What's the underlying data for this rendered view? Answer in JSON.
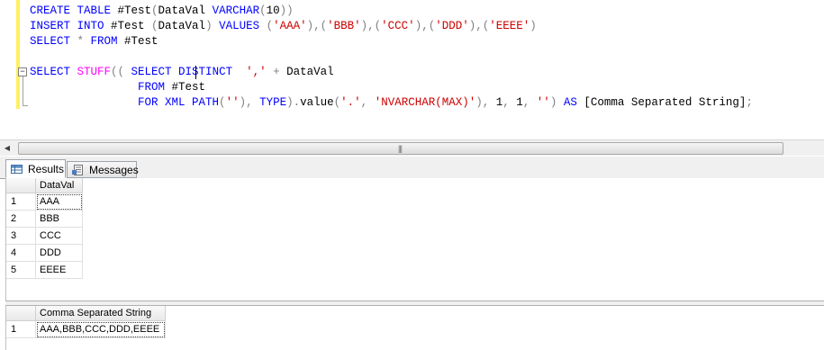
{
  "editor": {
    "lines": [
      [
        {
          "t": "CREATE TABLE",
          "c": "kw"
        },
        {
          "t": " #Test",
          "c": "plain"
        },
        {
          "t": "(",
          "c": "ob"
        },
        {
          "t": "DataVal ",
          "c": "plain"
        },
        {
          "t": "VARCHAR",
          "c": "kw"
        },
        {
          "t": "(",
          "c": "ob"
        },
        {
          "t": "10",
          "c": "plain"
        },
        {
          "t": "))",
          "c": "ob"
        }
      ],
      [
        {
          "t": "INSERT INTO",
          "c": "kw"
        },
        {
          "t": " #Test ",
          "c": "plain"
        },
        {
          "t": "(",
          "c": "ob"
        },
        {
          "t": "DataVal",
          "c": "plain"
        },
        {
          "t": ")",
          "c": "ob"
        },
        {
          "t": " VALUES ",
          "c": "kw"
        },
        {
          "t": "(",
          "c": "ob"
        },
        {
          "t": "'AAA'",
          "c": "str"
        },
        {
          "t": "),(",
          "c": "ob"
        },
        {
          "t": "'BBB'",
          "c": "str"
        },
        {
          "t": "),(",
          "c": "ob"
        },
        {
          "t": "'CCC'",
          "c": "str"
        },
        {
          "t": "),(",
          "c": "ob"
        },
        {
          "t": "'DDD'",
          "c": "str"
        },
        {
          "t": "),(",
          "c": "ob"
        },
        {
          "t": "'EEEE'",
          "c": "str"
        },
        {
          "t": ")",
          "c": "ob"
        }
      ],
      [
        {
          "t": "SELECT",
          "c": "kw"
        },
        {
          "t": " * ",
          "c": "op"
        },
        {
          "t": "FROM",
          "c": "kw"
        },
        {
          "t": " #Test",
          "c": "plain"
        }
      ],
      [],
      [
        {
          "t": "SELECT",
          "c": "kw"
        },
        {
          "t": " STUFF",
          "c": "fn"
        },
        {
          "t": "((",
          "c": "ob"
        },
        {
          "t": " SELECT DISTINCT  ",
          "c": "kw"
        },
        {
          "t": "','",
          "c": "str"
        },
        {
          "t": " + ",
          "c": "op"
        },
        {
          "t": "DataVal",
          "c": "plain"
        }
      ],
      [
        {
          "t": "                FROM",
          "c": "kw"
        },
        {
          "t": " #Test",
          "c": "plain"
        }
      ],
      [
        {
          "t": "                FOR XML PATH",
          "c": "kw"
        },
        {
          "t": "(",
          "c": "ob"
        },
        {
          "t": "''",
          "c": "str"
        },
        {
          "t": "),",
          "c": "ob"
        },
        {
          "t": " TYPE",
          "c": "kw"
        },
        {
          "t": ").",
          "c": "ob"
        },
        {
          "t": "value",
          "c": "plain"
        },
        {
          "t": "(",
          "c": "ob"
        },
        {
          "t": "'.'",
          "c": "str"
        },
        {
          "t": ", ",
          "c": "ob"
        },
        {
          "t": "'NVARCHAR(MAX)'",
          "c": "str"
        },
        {
          "t": "), ",
          "c": "ob"
        },
        {
          "t": "1",
          "c": "plain"
        },
        {
          "t": ", ",
          "c": "ob"
        },
        {
          "t": "1",
          "c": "plain"
        },
        {
          "t": ", ",
          "c": "ob"
        },
        {
          "t": "''",
          "c": "str"
        },
        {
          "t": ")",
          "c": "ob"
        },
        {
          "t": " AS ",
          "c": "kw"
        },
        {
          "t": "[Comma Separated String]",
          "c": "plain"
        },
        {
          "t": ";",
          "c": "ob"
        }
      ]
    ]
  },
  "tabs": {
    "results_label": "Results",
    "messages_label": "Messages"
  },
  "grid1": {
    "header": "DataVal",
    "rows": [
      {
        "num": "1",
        "val": "AAA"
      },
      {
        "num": "2",
        "val": "BBB"
      },
      {
        "num": "3",
        "val": "CCC"
      },
      {
        "num": "4",
        "val": "DDD"
      },
      {
        "num": "5",
        "val": "EEEE"
      }
    ]
  },
  "grid2": {
    "header": "Comma Separated String",
    "rows": [
      {
        "num": "1",
        "val": "AAA,BBB,CCC,DDD,EEEE"
      }
    ]
  },
  "colors": {
    "keyword": "#0000ff",
    "string": "#cc0000",
    "function": "#ff00ff",
    "operator": "#808080",
    "change_bar": "#ffef61"
  }
}
